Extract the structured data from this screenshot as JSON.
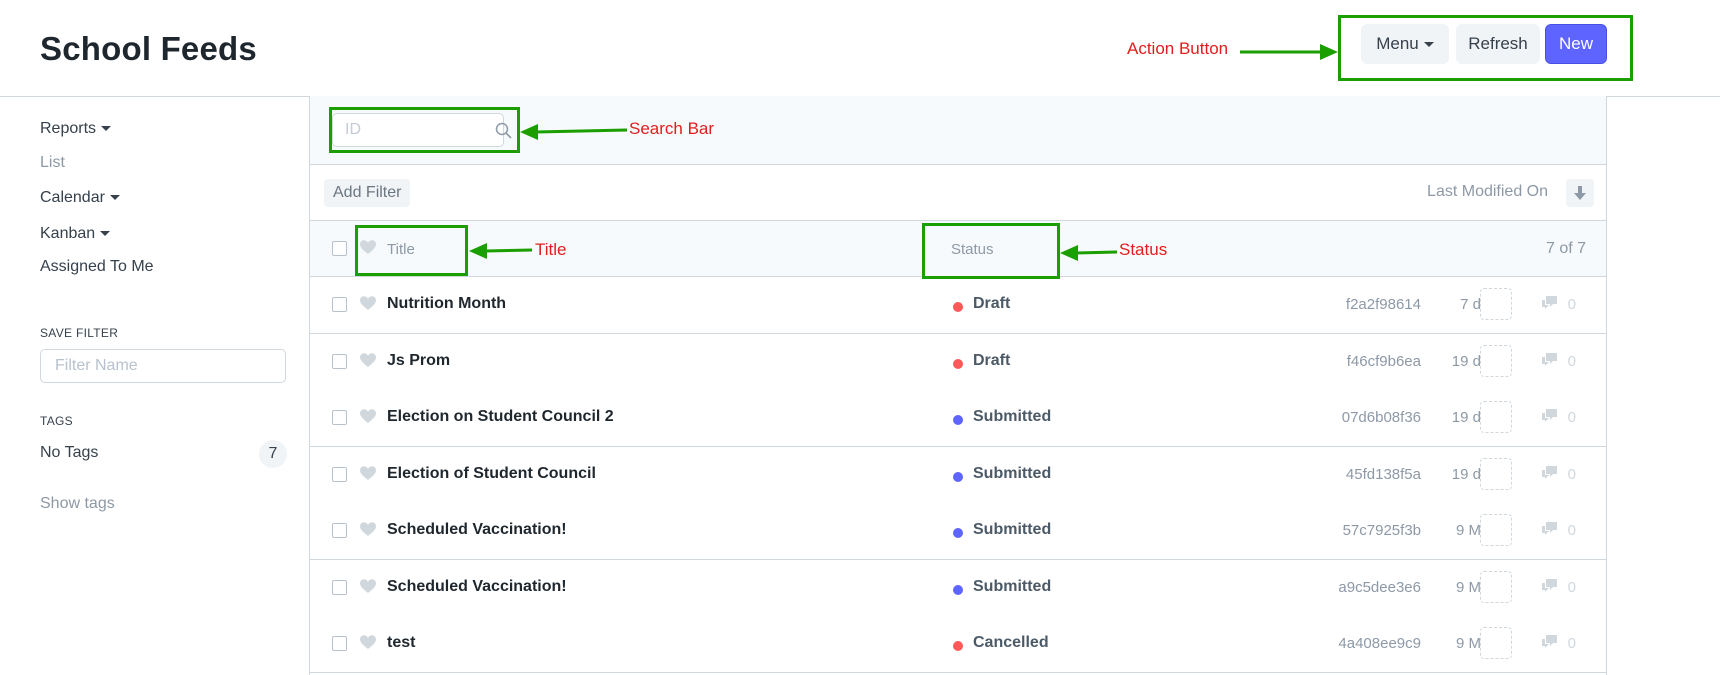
{
  "header": {
    "title": "School Feeds",
    "menu_label": "Menu",
    "refresh_label": "Refresh",
    "new_label": "New"
  },
  "sidebar": {
    "items": [
      {
        "label": "Reports",
        "dropdown": true
      },
      {
        "label": "List",
        "dropdown": false
      },
      {
        "label": "Calendar",
        "dropdown": true
      },
      {
        "label": "Kanban",
        "dropdown": true
      },
      {
        "label": "Assigned To Me",
        "dropdown": false
      }
    ],
    "save_filter_heading": "SAVE FILTER",
    "filter_name_placeholder": "Filter Name",
    "tags_heading": "TAGS",
    "no_tags_label": "No Tags",
    "no_tags_count": "7",
    "show_tags_label": "Show tags"
  },
  "list": {
    "search_placeholder": "ID",
    "add_filter_label": "Add Filter",
    "sort_label": "Last Modified On",
    "columns": {
      "title": "Title",
      "status": "Status"
    },
    "count_label": "7 of 7",
    "rows": [
      {
        "title": "Nutrition Month",
        "status": "Draft",
        "status_color": "#ff5858",
        "id": "f2a2f98614",
        "age": "7 d",
        "comments": "0"
      },
      {
        "title": "Js Prom",
        "status": "Draft",
        "status_color": "#ff5858",
        "id": "f46cf9b6ea",
        "age": "19 d",
        "comments": "0"
      },
      {
        "title": "Election on Student Council 2",
        "status": "Submitted",
        "status_color": "#5e64ff",
        "id": "07d6b08f36",
        "age": "19 d",
        "comments": "0"
      },
      {
        "title": "Election of Student Council",
        "status": "Submitted",
        "status_color": "#5e64ff",
        "id": "45fd138f5a",
        "age": "19 d",
        "comments": "0"
      },
      {
        "title": "Scheduled Vaccination!",
        "status": "Submitted",
        "status_color": "#5e64ff",
        "id": "57c7925f3b",
        "age": "9 M",
        "comments": "0"
      },
      {
        "title": "Scheduled Vaccination!",
        "status": "Submitted",
        "status_color": "#5e64ff",
        "id": "a9c5dee3e6",
        "age": "9 M",
        "comments": "0"
      },
      {
        "title": "test",
        "status": "Cancelled",
        "status_color": "#ff5858",
        "id": "4a408ee9c9",
        "age": "9 M",
        "comments": "0"
      }
    ]
  },
  "annotations": {
    "action_button": "Action Button",
    "search_bar": "Search Bar",
    "title": "Title",
    "status": "Status"
  },
  "colors": {
    "primary": "#5e64ff",
    "annotation_box": "#1a9e00",
    "annotation_text": "#e11d1d"
  }
}
